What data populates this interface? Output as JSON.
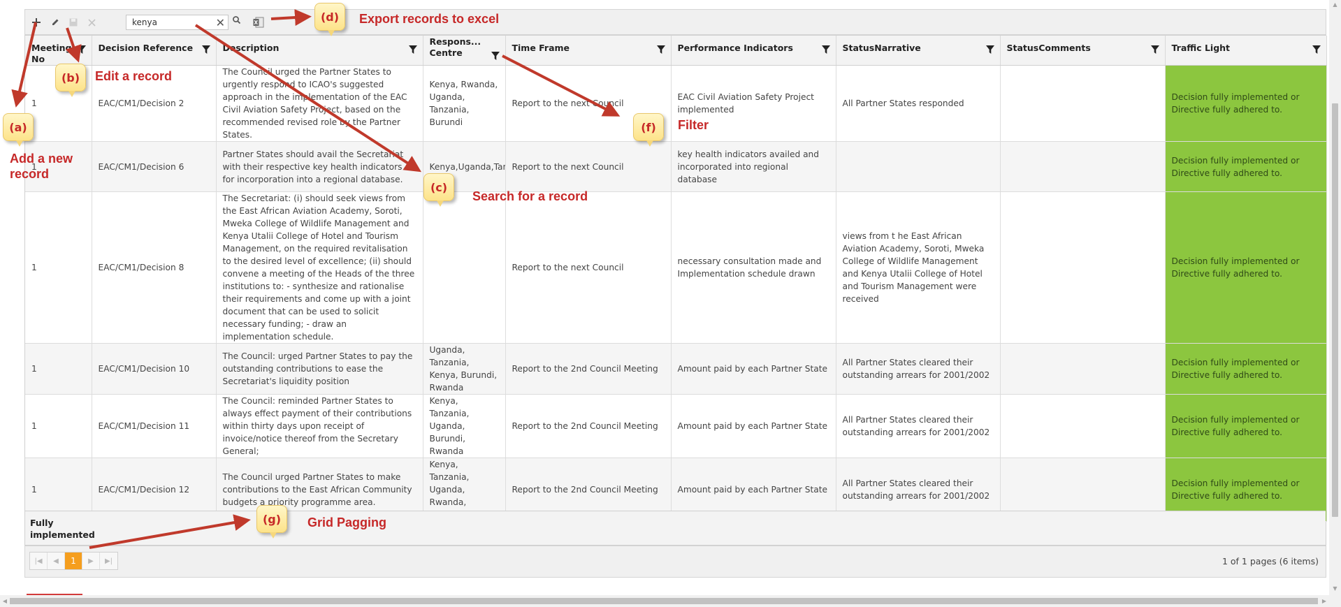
{
  "toolbar": {
    "search_value": "kenya",
    "buttons": [
      "add-icon",
      "edit-icon",
      "save-icon",
      "cancel-icon",
      "search-icon",
      "excel-icon"
    ]
  },
  "grid": {
    "columns": [
      {
        "label": "Meeting No"
      },
      {
        "label": "Decision Reference"
      },
      {
        "label": "Description"
      },
      {
        "label": "Respons... Centre"
      },
      {
        "label": "Time Frame"
      },
      {
        "label": "Performance Indicators"
      },
      {
        "label": "StatusNarrative"
      },
      {
        "label": "StatusComments"
      },
      {
        "label": "Traffic Light"
      }
    ],
    "rows": [
      {
        "meeting": "1",
        "ref": "EAC/CM1/Decision 2",
        "desc": "The Council urged the Partner States to urgently respond to ICAO's suggested approach in the implementation of the EAC Civil Aviation Safety Project, based on the recommended revised role by the Partner States.",
        "centre": "Kenya, Rwanda, Uganda, Tanzania, Burundi",
        "timeframe": "Report to the next Council",
        "indicators": "EAC Civil Aviation Safety Project implemented",
        "narrative": "All Partner States responded",
        "comments": "",
        "traffic": "Decision fully implemented or Directive fully adhered to."
      },
      {
        "meeting": "1",
        "ref": "EAC/CM1/Decision 6",
        "desc": "Partner States should avail the Secretariat with their respective key health indicators for incorporation into a regional database.",
        "centre": "Kenya,Uganda,Tanzania",
        "timeframe": "Report to the next Council",
        "indicators": "key health indicators availed and incorporated into regional database",
        "narrative": "",
        "comments": "",
        "traffic": "Decision fully implemented or Directive fully adhered to."
      },
      {
        "meeting": "1",
        "ref": "EAC/CM1/Decision 8",
        "desc": "The Secretariat: (i) should seek views from the East African Aviation Academy, Soroti, Mweka College of Wildlife Management and Kenya Utalii College of Hotel and Tourism Management, on the required revitalisation to the desired level of excellence; (ii) should convene a meeting of the Heads of the three institutions to: - synthesize and rationalise their requirements and come up with a joint document that can be used to solicit necessary funding; - draw an implementation schedule.",
        "centre": "",
        "timeframe": "Report to the next Council",
        "indicators": "necessary consultation made and Implementation schedule drawn",
        "narrative": "views from t he East African Aviation Academy, Soroti, Mweka College of Wildlife Management and Kenya Utalii College of Hotel and Tourism Management were received",
        "comments": "",
        "traffic": "Decision fully implemented or Directive fully adhered to."
      },
      {
        "meeting": "1",
        "ref": "EAC/CM1/Decision 10",
        "desc": "The Council: urged Partner States to pay the outstanding contributions to ease the Secretariat's liquidity position",
        "centre": "Uganda, Tanzania, Kenya, Burundi, Rwanda",
        "timeframe": "Report to the 2nd Council Meeting",
        "indicators": "Amount paid by each Partner State",
        "narrative": "All Partner States cleared their outstanding arrears for 2001/2002",
        "comments": "",
        "traffic": "Decision fully implemented or Directive fully adhered to."
      },
      {
        "meeting": "1",
        "ref": "EAC/CM1/Decision 11",
        "desc": "The Council: reminded Partner States to always effect payment of their contributions within thirty days upon receipt of invoice/notice thereof from the Secretary General;",
        "centre": "Kenya, Tanzania, Uganda, Burundi, Rwanda",
        "timeframe": "Report to the 2nd Council Meeting",
        "indicators": "Amount paid by each Partner State",
        "narrative": "All Partner States cleared their outstanding arrears for 2001/2002",
        "comments": "",
        "traffic": "Decision fully implemented or Directive fully adhered to."
      },
      {
        "meeting": "1",
        "ref": "EAC/CM1/Decision 12",
        "desc": "The Council urged Partner States to make contributions to the East African Community budgets a priority programme area.",
        "centre": "Kenya, Tanzania, Uganda, Rwanda, Burundi",
        "timeframe": "Report to the 2nd Council Meeting",
        "indicators": "Amount paid by each Partner State",
        "narrative": "All Partner States cleared their outstanding arrears for 2001/2002",
        "comments": "",
        "traffic": "Decision fully implemented or Directive fully adhered to."
      }
    ],
    "group_footer": "Fully implemented",
    "traffic_color": "#8cc63f"
  },
  "pager": {
    "current_page": "1",
    "info": "1 of 1 pages (6 items)",
    "accent": "#f59e1e"
  },
  "annotations": [
    {
      "tag": "(a)",
      "label": "Add a new record"
    },
    {
      "tag": "(b)",
      "label": "Edit a record"
    },
    {
      "tag": "(c)",
      "label": "Search for a record"
    },
    {
      "tag": "(d)",
      "label": "Export records to excel"
    },
    {
      "tag": "(f)",
      "label": "Filter"
    },
    {
      "tag": "(g)",
      "label": "Grid Pagging"
    }
  ],
  "annotation_color": "#c62828"
}
